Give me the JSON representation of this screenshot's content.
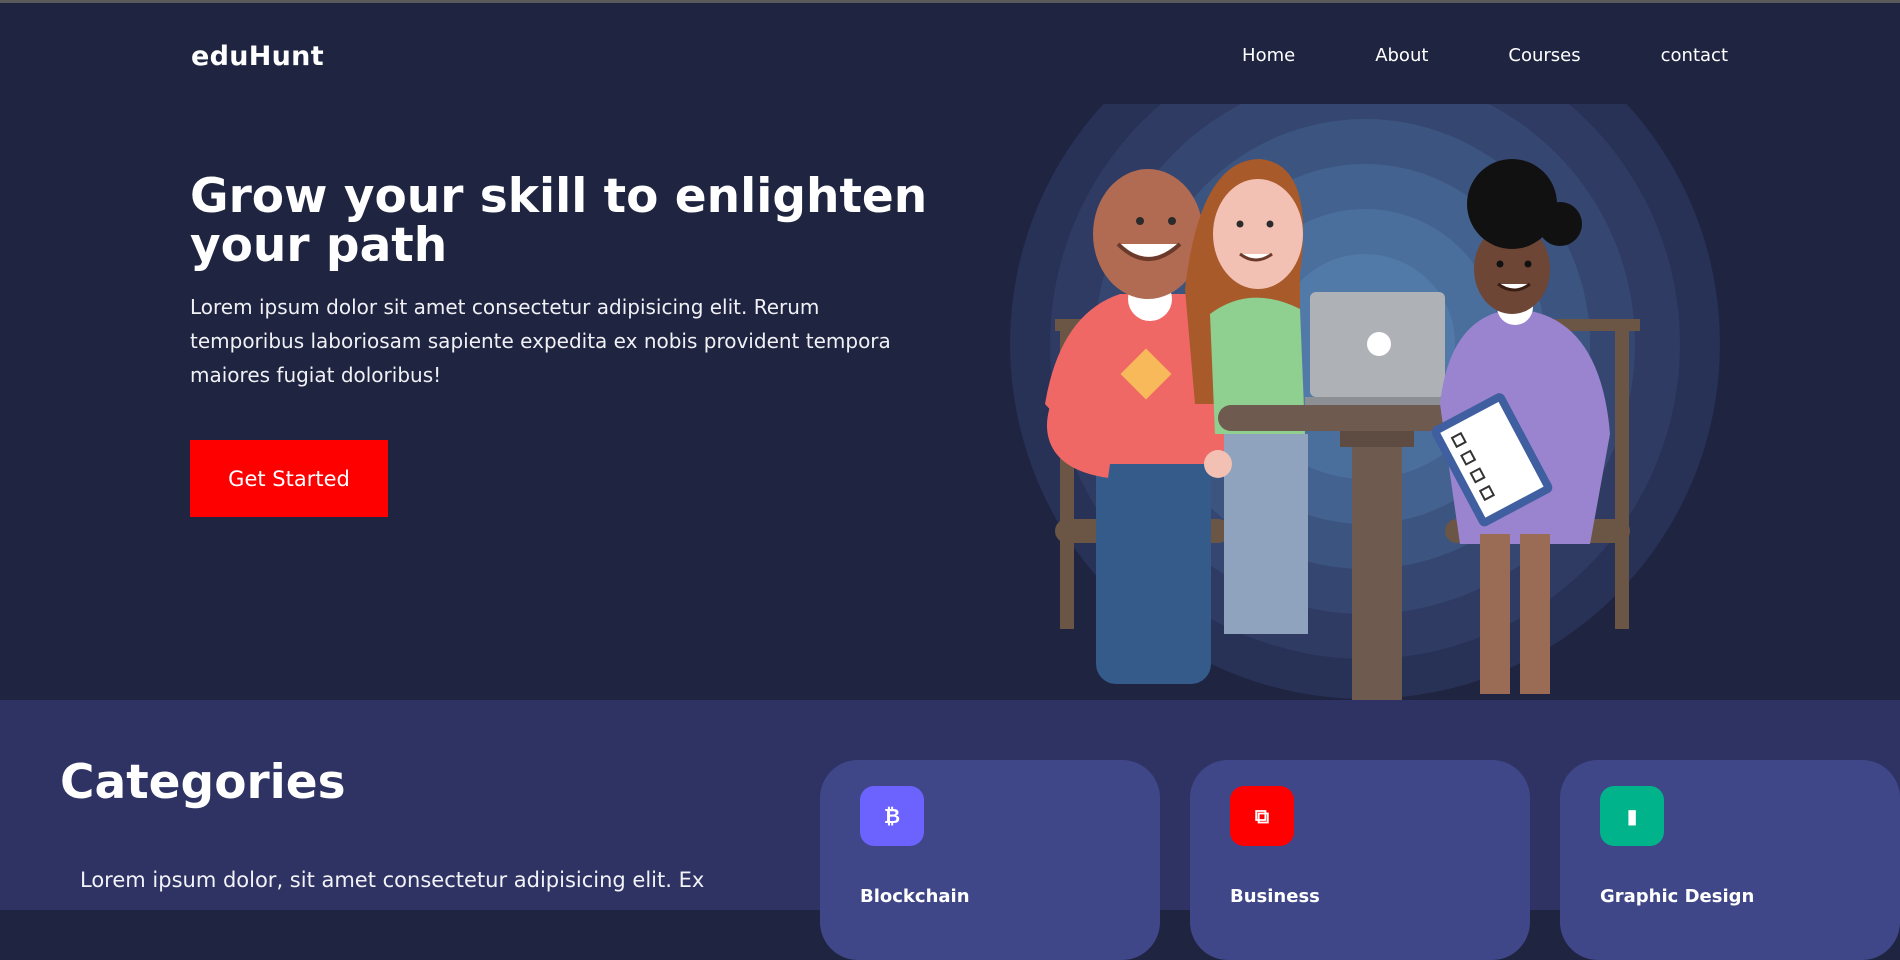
{
  "brand": {
    "name": "eduHunt"
  },
  "nav": {
    "items": [
      "Home",
      "About",
      "Courses",
      "contact"
    ]
  },
  "hero": {
    "title": "Grow your skill to enlighten your path",
    "description": "Lorem ipsum dolor sit amet consectetur adipisicing elit. Rerum temporibus laboriosam sapiente expedita ex nobis provident tempora maiores fugiat doloribus!",
    "cta_label": "Get Started"
  },
  "categories": {
    "title": "Categories",
    "description": "Lorem ipsum dolor, sit amet consectetur adipisicing elit. Ex",
    "cards": [
      {
        "name": "Blockchain",
        "icon": "bitcoin-icon",
        "color": "#6c63ff"
      },
      {
        "name": "Business",
        "icon": "puzzle-icon",
        "color": "#ff0000"
      },
      {
        "name": "Graphic Design",
        "icon": "bar-chart-icon",
        "color": "#00b38a"
      }
    ]
  },
  "colors": {
    "background": "#1f2541",
    "accent": "#ff0000",
    "section": "#2e3363",
    "card": "#404789"
  }
}
